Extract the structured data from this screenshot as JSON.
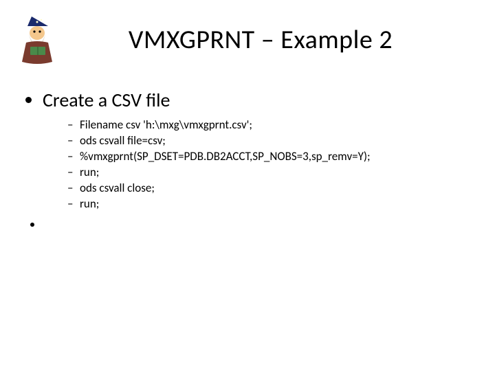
{
  "title": "VMXGPRNT – Example 2",
  "icon_name": "wizard-clipart-icon",
  "bullets": {
    "main": "Create a CSV file",
    "code": [
      "Filename csv 'h:\\mxg\\vmxgprnt.csv';",
      "ods csvall file=csv;",
      "%vmxgprnt(SP_DSET=PDB.DB2ACCT,SP_NOBS=3,sp_remv=Y);",
      "run;",
      "ods csvall close;",
      "run;"
    ]
  }
}
